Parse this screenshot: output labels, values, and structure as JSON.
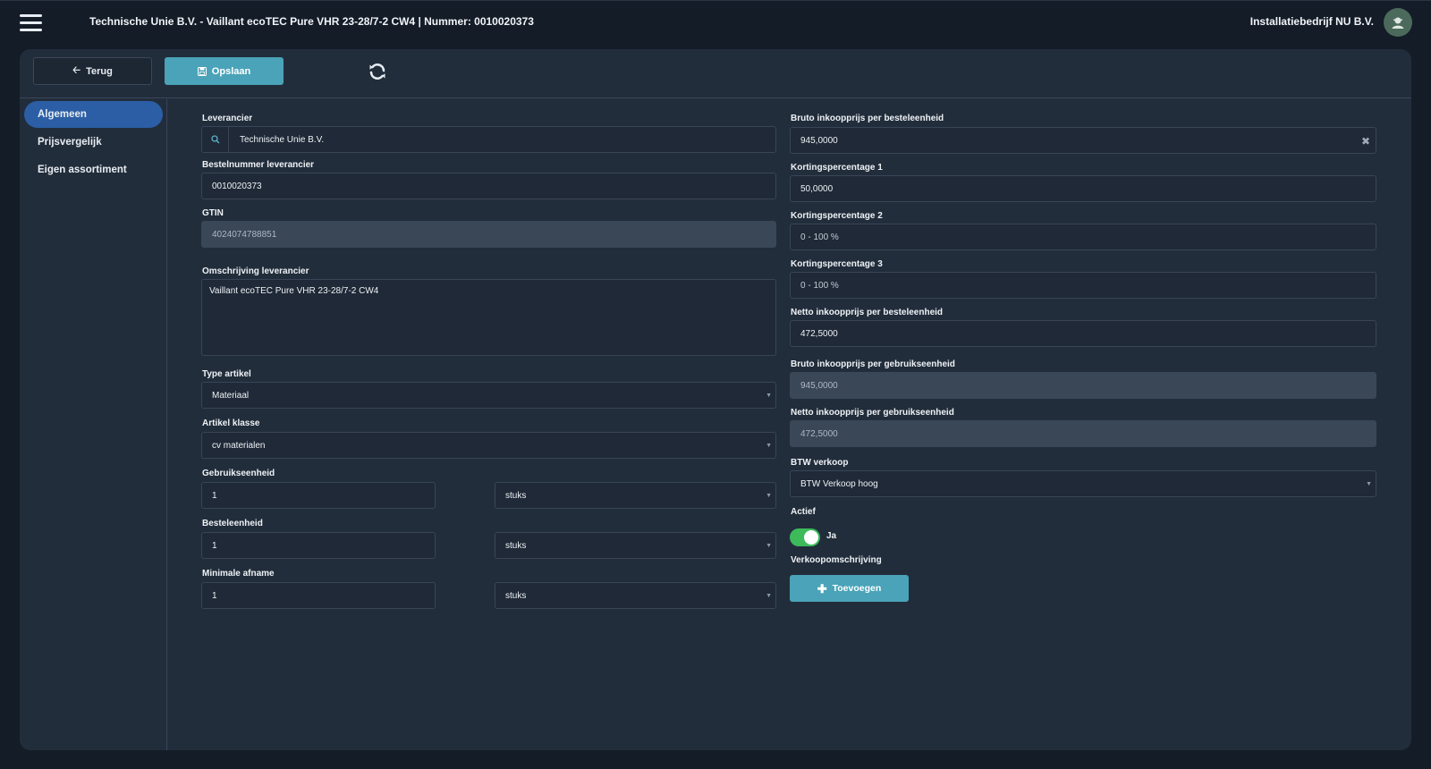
{
  "header": {
    "title": "Technische Unie B.V. - Vaillant ecoTEC Pure VHR 23-28/7-2 CW4 | Nummer: 0010020373",
    "company": "Installatiebedrijf NU B.V."
  },
  "toolbar": {
    "back_label": "Terug",
    "save_label": "Opslaan"
  },
  "sidebar": {
    "items": [
      {
        "label": "Algemeen",
        "active": true
      },
      {
        "label": "Prijsvergelijk",
        "active": false
      },
      {
        "label": "Eigen assortiment",
        "active": false
      }
    ]
  },
  "left": {
    "leverancier": {
      "label": "Leverancier",
      "value": "Technische Unie B.V."
    },
    "bestelnummer": {
      "label": "Bestelnummer leverancier",
      "value": "0010020373"
    },
    "gtin": {
      "label": "GTIN",
      "value": "4024074788851"
    },
    "omschrijving": {
      "label": "Omschrijving leverancier",
      "value": "Vaillant ecoTEC Pure VHR 23-28/7-2 CW4"
    },
    "type_artikel": {
      "label": "Type artikel",
      "value": "Materiaal"
    },
    "artikel_klasse": {
      "label": "Artikel klasse",
      "value": "cv materialen"
    },
    "gebruikseenheid": {
      "label": "Gebruikseenheid",
      "value": "1",
      "unit": "stuks"
    },
    "besteleenheid": {
      "label": "Besteleenheid",
      "value": "1",
      "unit": "stuks"
    },
    "minimale_afname": {
      "label": "Minimale afname",
      "value": "1",
      "unit": "stuks"
    }
  },
  "right": {
    "bruto_best": {
      "label": "Bruto inkoopprijs per besteleenheid",
      "value": "945,0000"
    },
    "korting1": {
      "label": "Kortingspercentage 1",
      "value": "50,0000"
    },
    "korting2": {
      "label": "Kortingspercentage 2",
      "placeholder": "0 - 100 %"
    },
    "korting3": {
      "label": "Kortingspercentage 3",
      "placeholder": "0 - 100 %"
    },
    "netto_best": {
      "label": "Netto inkoopprijs per besteleenheid",
      "value": "472,5000"
    },
    "bruto_gebr": {
      "label": "Bruto inkoopprijs per gebruikseenheid",
      "value": "945,0000"
    },
    "netto_gebr": {
      "label": "Netto inkoopprijs per gebruikseenheid",
      "value": "472,5000"
    },
    "btw": {
      "label": "BTW verkoop",
      "value": "BTW Verkoop hoog"
    },
    "actief": {
      "label": "Actief",
      "value_label": "Ja",
      "on": true
    },
    "verkoop": {
      "label": "Verkoopomschrijving",
      "add_label": "Toevoegen"
    }
  },
  "colors": {
    "accent": "#4aa3b8",
    "active_nav": "#2b5ea4",
    "toggle_on": "#3dbb5a",
    "card_bg": "#222d3b"
  }
}
